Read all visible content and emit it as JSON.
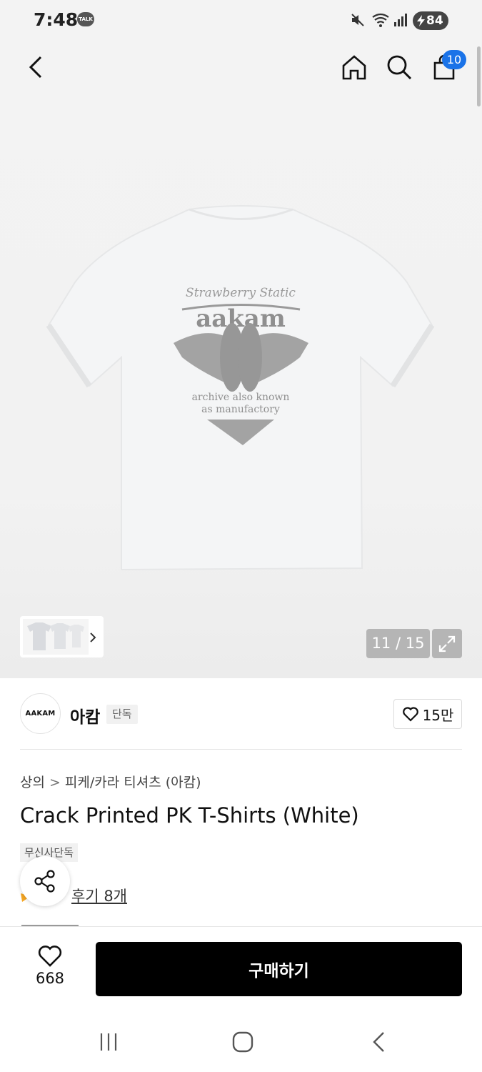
{
  "status_bar": {
    "time": "7:48",
    "talk_badge": "TALK",
    "battery": "84"
  },
  "header": {
    "cart_count": "10",
    "icons": [
      "back-arrow-icon",
      "home-icon",
      "search-icon",
      "cart-icon"
    ]
  },
  "gallery": {
    "image_counter": "11 / 15",
    "shirt_print": {
      "script_line": "Strawberry Static",
      "logo": "aakam",
      "tagline1": "archive also known",
      "tagline2": "as manufactory"
    }
  },
  "brand": {
    "logo_text": "AAKAM",
    "name": "아캄",
    "tag": "단독",
    "likes": "15만"
  },
  "product": {
    "breadcrumb": [
      "상의",
      "피케/카라 티셔츠 (아캄)"
    ],
    "title": "Crack Printed PK T-Shirts (White)",
    "exclusive_tag": "무신사단독",
    "review_link": "후기 8개"
  },
  "buy_bar": {
    "wish_count": "668",
    "buy_label": "구매하기"
  },
  "colors": {
    "accent_badge": "#1a73e8",
    "buy_button": "#000000",
    "star": "#f5a623"
  }
}
